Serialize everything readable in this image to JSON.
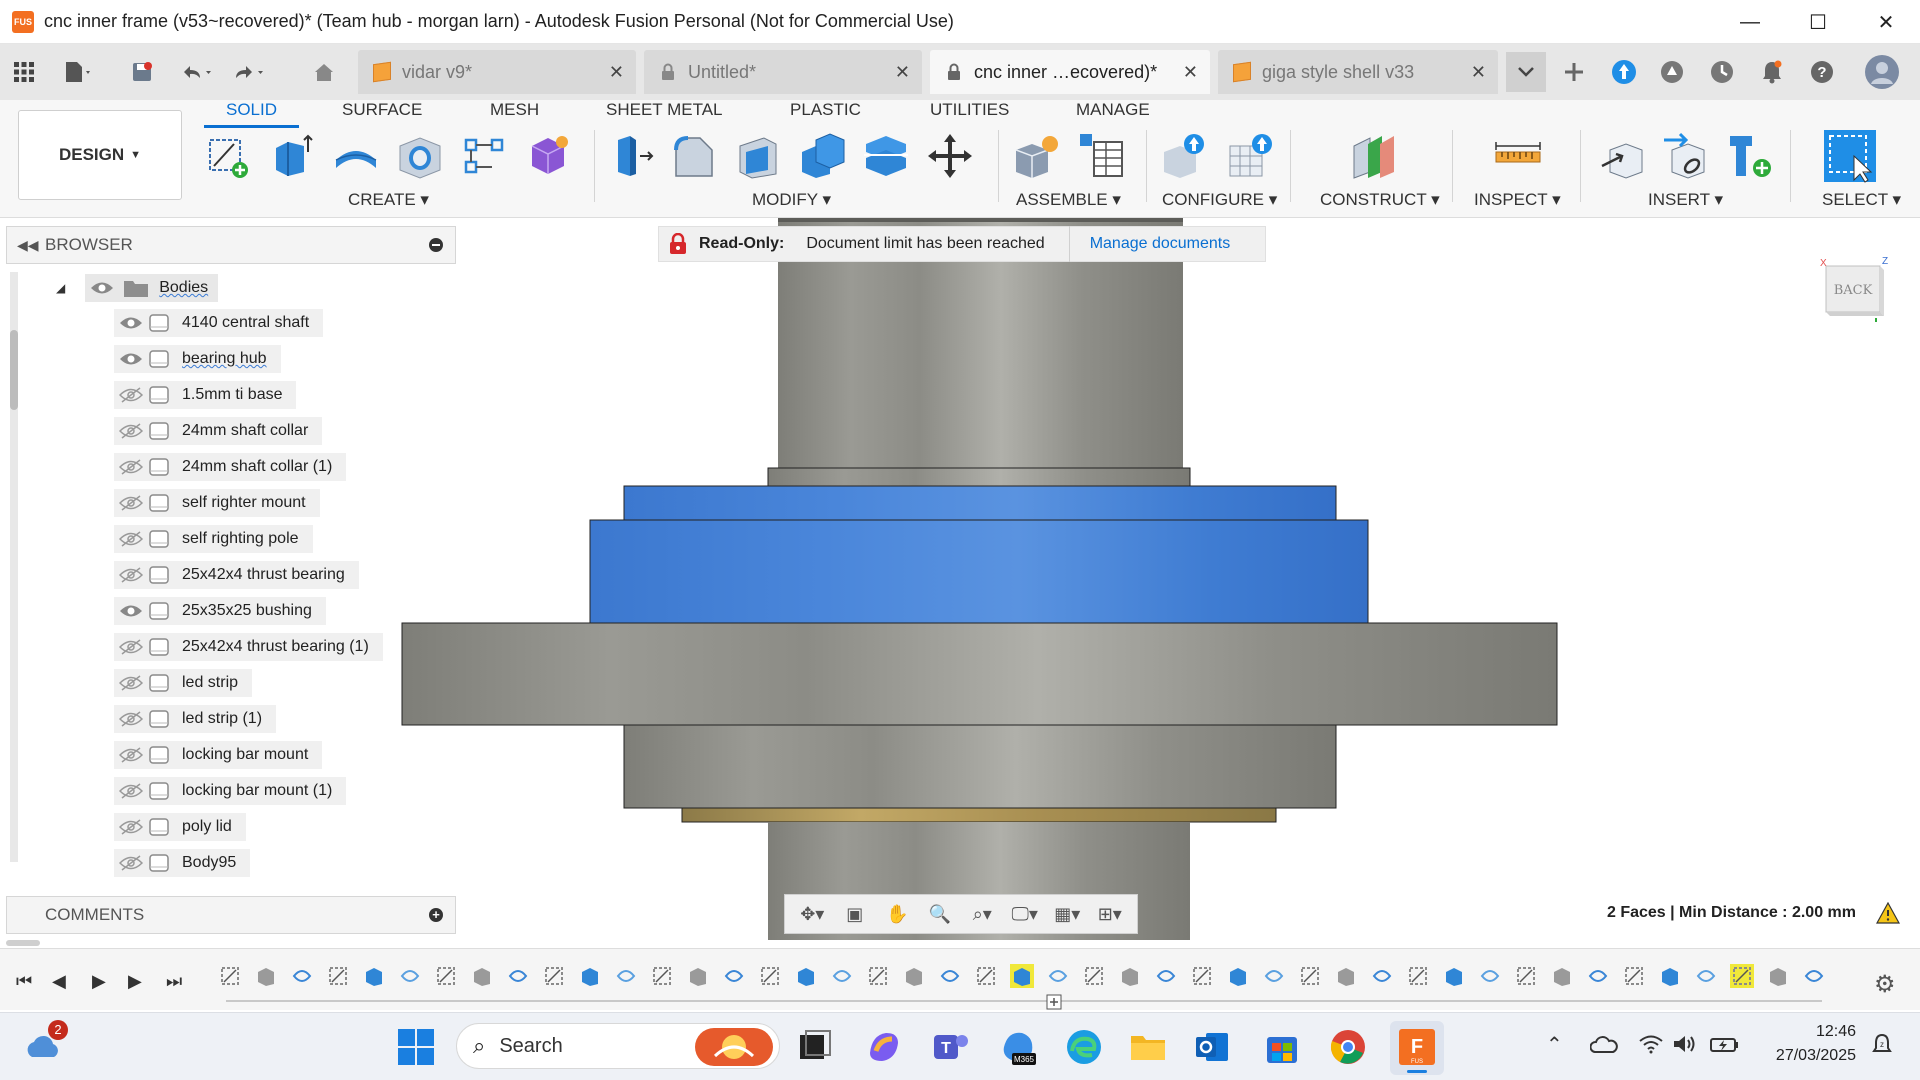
{
  "window": {
    "title": "cnc inner frame (v53~recovered)* (Team hub - morgan larn) - Autodesk Fusion Personal (Not for Commercial Use)",
    "logo_text": "FUS",
    "minimize": "—",
    "maximize": "☐",
    "close": "✕"
  },
  "tabs": [
    {
      "label": "vidar v9*",
      "icon": "orange-cube-icon",
      "active": false
    },
    {
      "label": "Untitled*",
      "icon": "lock-icon",
      "active": false
    },
    {
      "label": "cnc inner …ecovered)*",
      "icon": "lock-icon",
      "active": true
    },
    {
      "label": "giga style shell v33",
      "icon": "orange-cube-icon",
      "active": false
    }
  ],
  "toolbar": {
    "workspace": "DESIGN",
    "tabs": [
      "SOLID",
      "SURFACE",
      "MESH",
      "SHEET METAL",
      "PLASTIC",
      "UTILITIES",
      "MANAGE"
    ],
    "active_tab": "SOLID",
    "groups": [
      "CREATE",
      "MODIFY",
      "ASSEMBLE",
      "CONFIGURE",
      "CONSTRUCT",
      "INSPECT",
      "INSERT",
      "SELECT"
    ]
  },
  "browser": {
    "title": "BROWSER",
    "folder": "Bodies",
    "bodies": [
      {
        "label": "4140 central shaft",
        "visible": true
      },
      {
        "label": "bearing hub",
        "visible": true
      },
      {
        "label": "1.5mm ti base",
        "visible": false
      },
      {
        "label": "24mm shaft collar",
        "visible": false
      },
      {
        "label": "24mm shaft collar (1)",
        "visible": false
      },
      {
        "label": "self righter mount",
        "visible": false
      },
      {
        "label": "self righting pole",
        "visible": false
      },
      {
        "label": "25x42x4 thrust bearing",
        "visible": false
      },
      {
        "label": "25x35x25 bushing",
        "visible": true
      },
      {
        "label": "25x42x4 thrust bearing (1)",
        "visible": false
      },
      {
        "label": "led strip",
        "visible": false
      },
      {
        "label": "led strip (1)",
        "visible": false
      },
      {
        "label": "locking bar mount",
        "visible": false
      },
      {
        "label": "locking bar mount (1)",
        "visible": false
      },
      {
        "label": "poly lid",
        "visible": false
      },
      {
        "label": "Body95",
        "visible": false
      }
    ]
  },
  "comments": {
    "title": "COMMENTS"
  },
  "banner": {
    "label": "Read-Only:",
    "message": "Document limit has been reached",
    "link": "Manage documents"
  },
  "viewcube": {
    "face": "BACK"
  },
  "status": {
    "text": "2 Faces | Min Distance : 2.00 mm"
  },
  "taskbar": {
    "search": "Search",
    "notification_count": "2",
    "time": "12:46",
    "date": "27/03/2025"
  },
  "colors": {
    "accent": "#0a6fd1",
    "selected_face": "#3f7fd6",
    "metal": "#8a8a84",
    "brass": "#b49a5a"
  }
}
